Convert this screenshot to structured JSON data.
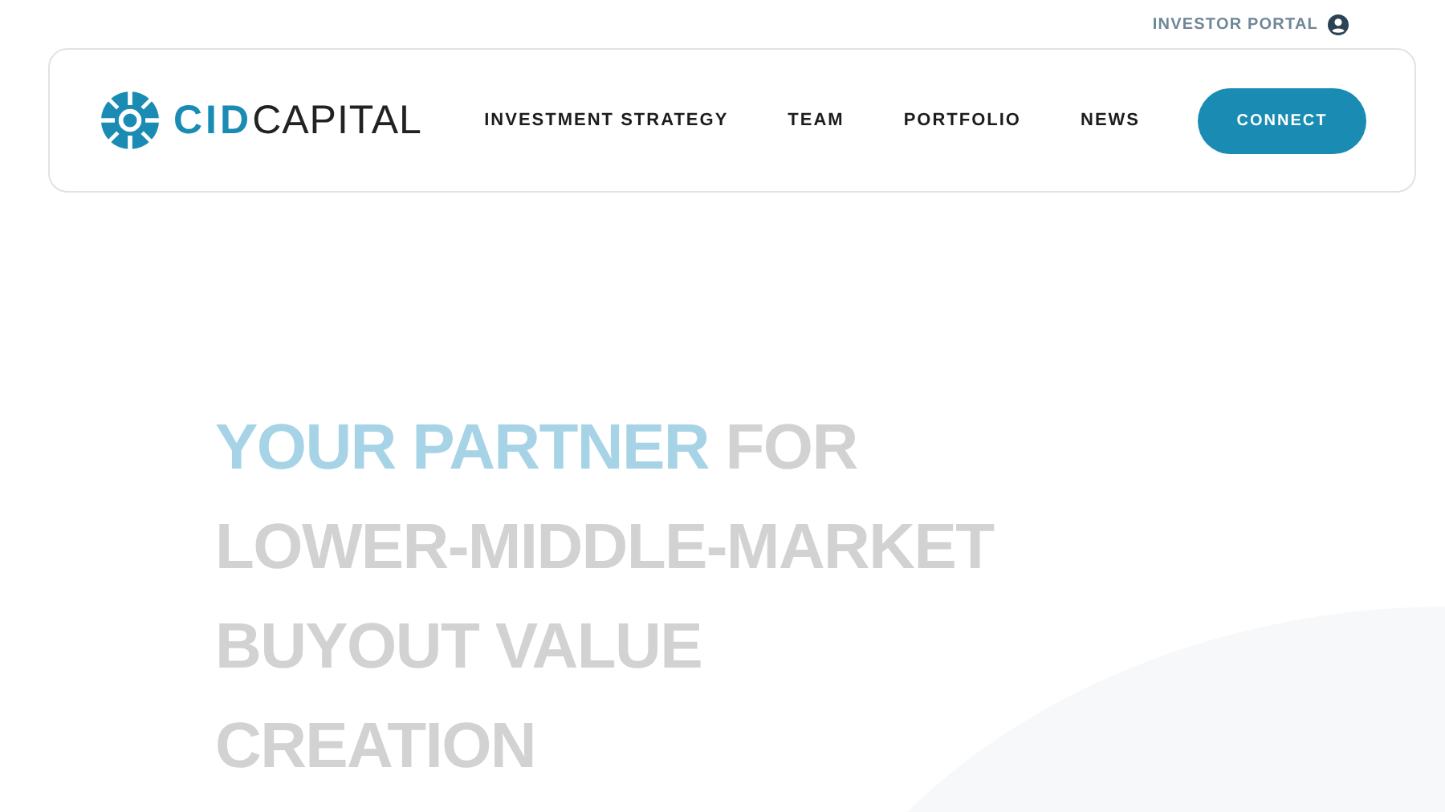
{
  "top_link": {
    "label": "INVESTOR PORTAL"
  },
  "logo": {
    "bold": "CID",
    "light": "CAPITAL"
  },
  "nav": [
    {
      "label": "INVESTMENT STRATEGY"
    },
    {
      "label": "TEAM"
    },
    {
      "label": "PORTFOLIO"
    },
    {
      "label": "NEWS"
    }
  ],
  "cta": {
    "label": "CONNECT"
  },
  "headline": {
    "accent": "YOUR PARTNER",
    "lines": [
      "FOR",
      "LOWER-MIDDLE-MARKET",
      "BUYOUT VALUE",
      "CREATION"
    ]
  }
}
